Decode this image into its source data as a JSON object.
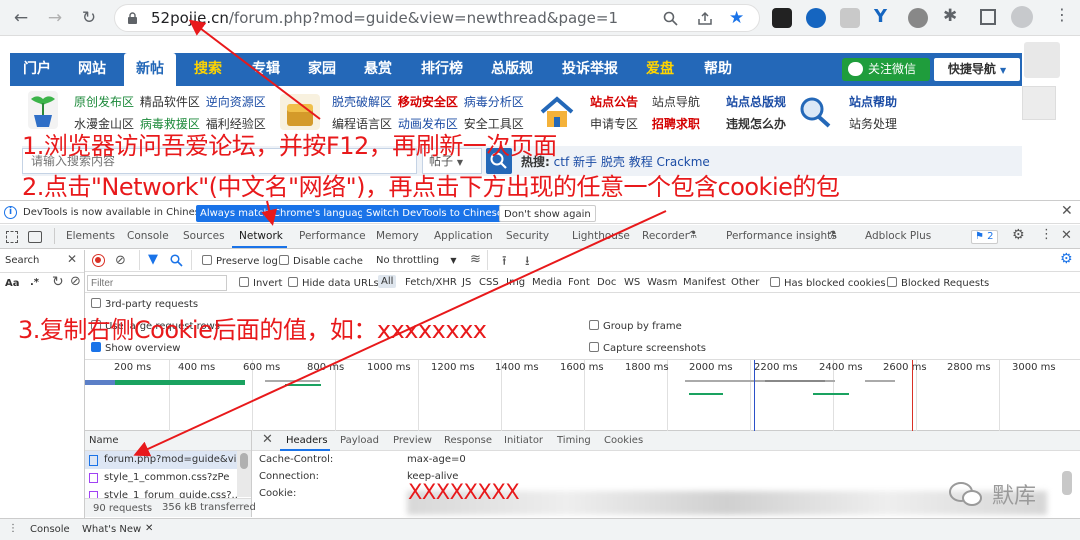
{
  "browser": {
    "url_domain": "52pojie.cn",
    "url_path": "/forum.php?mod=guide&view=newthread&page=1"
  },
  "site": {
    "nav": [
      "门户",
      "网站",
      "新帖",
      "搜索",
      "专辑",
      "家园",
      "悬赏",
      "排行榜",
      "总版规",
      "投诉举报",
      "爱盘",
      "帮助"
    ],
    "wechat_follow": "关注微信",
    "quick_nav": "快捷导航",
    "links_col1_row1": [
      "原创发布区",
      "精品软件区",
      "逆向资源区"
    ],
    "links_col1_row2": [
      "水漫金山区",
      "病毒救援区",
      "福利经验区"
    ],
    "links_col2_row1": [
      "脱壳破解区",
      "移动安全区",
      "病毒分析区"
    ],
    "links_col2_row2": [
      "编程语言区",
      "动画发布区",
      "安全工具区"
    ],
    "links_col3_row1": [
      "站点公告",
      "站点导航"
    ],
    "links_col3_row2": [
      "申请专区",
      "招聘求职"
    ],
    "links_col4_row1": "站点总版规",
    "links_col4_row2": "违规怎么办",
    "links_col5_row1": "站点帮助",
    "links_col5_row2": "站务处理",
    "search_placeholder": "请输入搜索内容",
    "search_type": "帖子",
    "hot_label": "热搜:",
    "hot_terms": [
      "ctf",
      "新手",
      "脱壳",
      "教程",
      "Crackme"
    ]
  },
  "annotations": {
    "step1": "1.浏览器访问吾爱论坛，并按F12，再刷新一次页面",
    "step2": "2.点击\"Network\"(中文名\"网络\")，再点击下方出现的任意一个包含cookie的包",
    "step3": "3.复制右侧Cookie后面的值，如：xxxxxxxx",
    "cookie_example": "XXXXXXXX"
  },
  "devtools": {
    "info_text": "DevTools is now available in Chinese!",
    "btn_match": "Always match Chrome's language",
    "btn_switch": "Switch DevTools to Chinese",
    "btn_dont": "Don't show again",
    "tabs": [
      "Elements",
      "Console",
      "Sources",
      "Network",
      "Performance",
      "Memory",
      "Application",
      "Security",
      "Lighthouse",
      "Recorder",
      "Performance insights",
      "Adblock Plus"
    ],
    "issues_count": "2",
    "search_label": "Search",
    "preserve_log": "Preserve log",
    "disable_cache": "Disable cache",
    "throttling": "No throttling",
    "filter_placeholder": "Filter",
    "invert": "Invert",
    "hide_data_urls": "Hide data URLs",
    "filter_types": [
      "All",
      "Fetch/XHR",
      "JS",
      "CSS",
      "Img",
      "Media",
      "Font",
      "Doc",
      "WS",
      "Wasm",
      "Manifest",
      "Other"
    ],
    "has_blocked_cookies": "Has blocked cookies",
    "blocked_requests": "Blocked Requests",
    "third_party": "3rd-party requests",
    "use_large_rows": "Use large request rows",
    "show_overview": "Show overview",
    "group_by_frame": "Group by frame",
    "capture_screenshots": "Capture screenshots",
    "timeline_ticks": [
      "200 ms",
      "400 ms",
      "600 ms",
      "800 ms",
      "1000 ms",
      "1200 ms",
      "1400 ms",
      "1600 ms",
      "1800 ms",
      "2000 ms",
      "2200 ms",
      "2400 ms",
      "2600 ms",
      "2800 ms",
      "3000 ms"
    ],
    "name_header": "Name",
    "requests": [
      "forum.php?mod=guide&vi...",
      "style_1_common.css?zPe",
      "style_1_forum_guide.css?..."
    ],
    "requests_count": "90 requests",
    "transferred": "356 kB transferred",
    "detail_tabs": [
      "Headers",
      "Payload",
      "Preview",
      "Response",
      "Initiator",
      "Timing",
      "Cookies"
    ],
    "headers": [
      {
        "name": "Cache-Control:",
        "value": "max-age=0"
      },
      {
        "name": "Connection:",
        "value": "keep-alive"
      },
      {
        "name": "Cookie:",
        "value": ""
      }
    ],
    "drawer_tabs": [
      "Console",
      "What's New"
    ]
  },
  "watermark": "默库"
}
